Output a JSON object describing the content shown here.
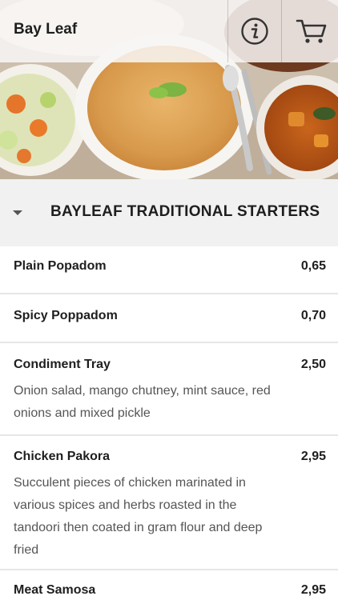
{
  "app": {
    "title": "Bay Leaf"
  },
  "toolbar": {
    "info_icon": "info-icon",
    "cart_icon": "cart-icon"
  },
  "section": {
    "title": "BAYLEAF TRADITIONAL STARTERS",
    "expanded": true
  },
  "items": [
    {
      "name": "Plain Popadom",
      "price": "0,65",
      "description": ""
    },
    {
      "name": "Spicy Poppadom",
      "price": "0,70",
      "description": ""
    },
    {
      "name": "Condiment Tray",
      "price": "2,50",
      "description": "Onion salad, mango chutney, mint sauce, red onions and mixed pickle"
    },
    {
      "name": "Chicken Pakora",
      "price": "2,95",
      "description": "Succulent pieces of chicken marinated in various spices and herbs roasted in the tandoori then coated in gram flour and deep fried"
    },
    {
      "name": "Meat Samosa",
      "price": "2,95",
      "description": ""
    }
  ]
}
